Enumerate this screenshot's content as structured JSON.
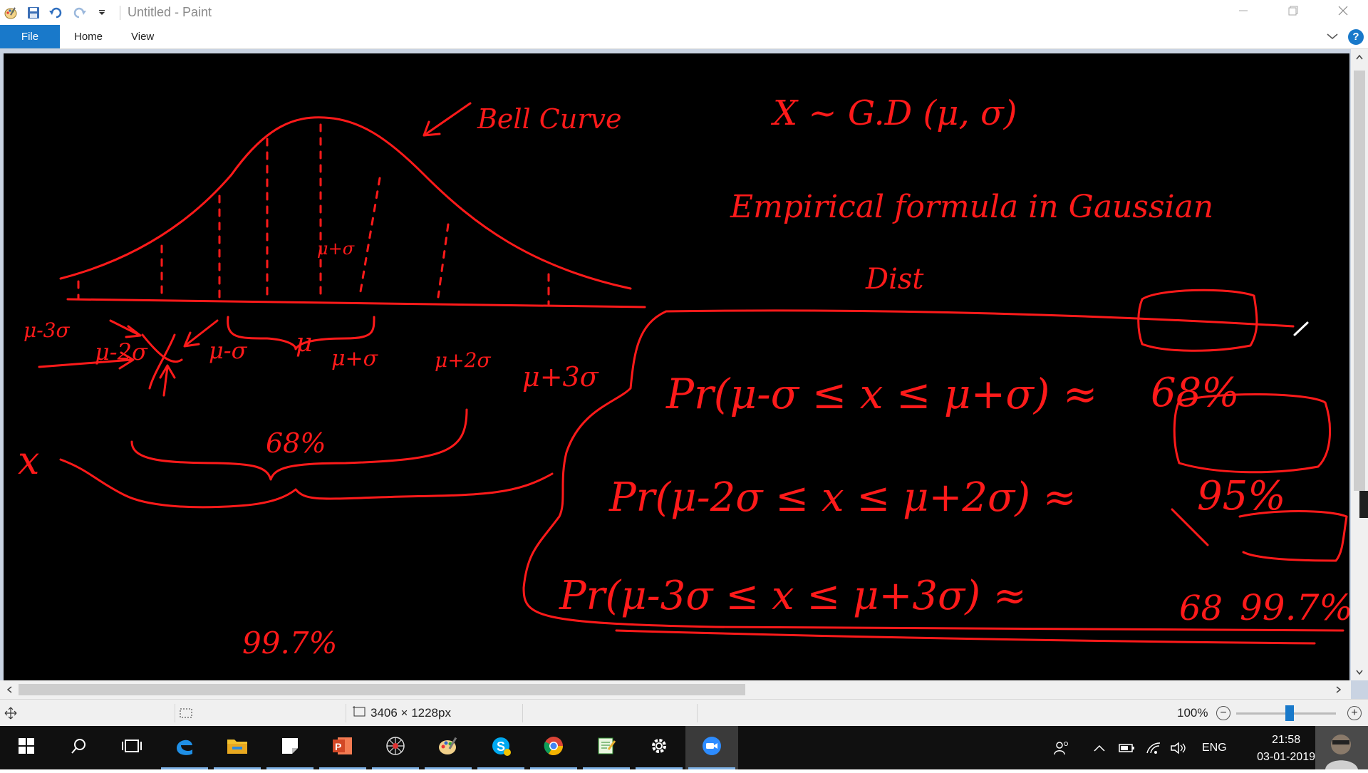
{
  "window": {
    "title": "Untitled - Paint"
  },
  "ribbon": {
    "tabs": [
      "File",
      "Home",
      "View"
    ]
  },
  "icons": {
    "app": "paint-icon",
    "save": "save-icon",
    "undo": "undo-icon",
    "redo": "redo-icon",
    "customize": "chevron-down-icon",
    "minimize": "minimize-icon",
    "restore": "restore-icon",
    "close": "close-icon",
    "collapse": "chevron-up-icon",
    "help": "help-icon"
  },
  "canvas": {
    "bell_label": "Bell Curve",
    "notation": "X ~ G.D (μ, σ)",
    "heading_line1": "Empirical formula in Gaussian",
    "heading_line2": "Dist",
    "axis_labels": [
      "μ-3σ",
      "μ-2σ",
      "μ-σ",
      "μ",
      "μ+σ",
      "μ+2σ",
      "μ+3σ"
    ],
    "center_label": "μ+σ",
    "x_label": "x",
    "pct_68": "68%",
    "pct_997": "99.7%",
    "formulas": [
      {
        "text": "Pr(μ-σ ≤ x ≤ μ+σ) ≈",
        "result": "68%"
      },
      {
        "text": "Pr(μ-2σ ≤ x ≤ μ+2σ) ≈",
        "result": "95%"
      },
      {
        "text": "Pr(μ-3σ ≤ x ≤ μ+3σ) ≈",
        "struck": "68",
        "result": "99.7%"
      }
    ]
  },
  "statusbar": {
    "dimensions": "3406 × 1228px",
    "zoom": "100%"
  },
  "taskbar": {
    "language": "ENG",
    "time": "21:58",
    "date": "03-01-2019",
    "apps": [
      "start",
      "search",
      "task-view",
      "edge",
      "file-explorer",
      "sticky-notes",
      "powerpoint",
      "spider-app",
      "paint",
      "skype",
      "chrome",
      "notepad-app",
      "settings",
      "zoom"
    ]
  },
  "colors": {
    "ink": "#ff1a1a",
    "accent": "#1979ca",
    "canvas": "#000000"
  }
}
